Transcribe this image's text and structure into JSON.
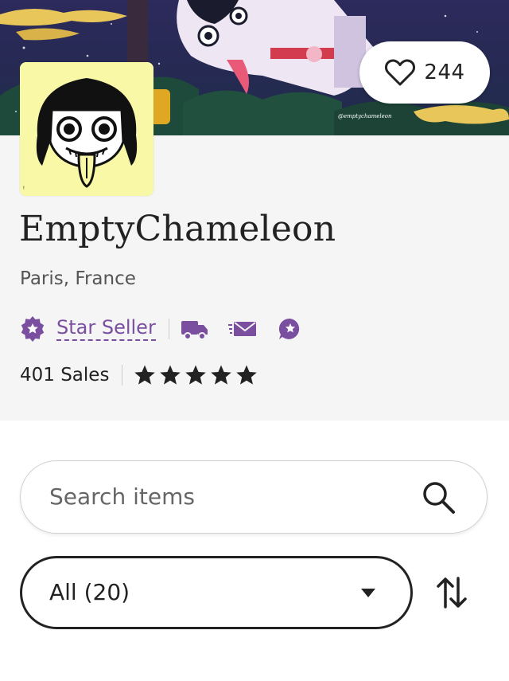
{
  "banner": {
    "watermark": "@emptychameleon",
    "favorite_count": "244",
    "favorite_icon": "heart-outline-icon"
  },
  "shop": {
    "name": "EmptyChameleon",
    "location": "Paris, France",
    "star_seller_label": "Star Seller",
    "star_seller_icon": "star-seller-badge-icon",
    "badge_icons": [
      "delivery-truck-icon",
      "fast-message-icon",
      "star-chat-icon"
    ],
    "sales": "401 Sales",
    "rating": 5,
    "rating_max": 5,
    "accent_color": "#7a4fa0"
  },
  "search": {
    "placeholder": "Search items",
    "value": "",
    "icon": "search-icon"
  },
  "filter": {
    "selected": "All (20)",
    "caret_icon": "caret-down-icon",
    "sort_icon": "sort-arrows-icon"
  }
}
